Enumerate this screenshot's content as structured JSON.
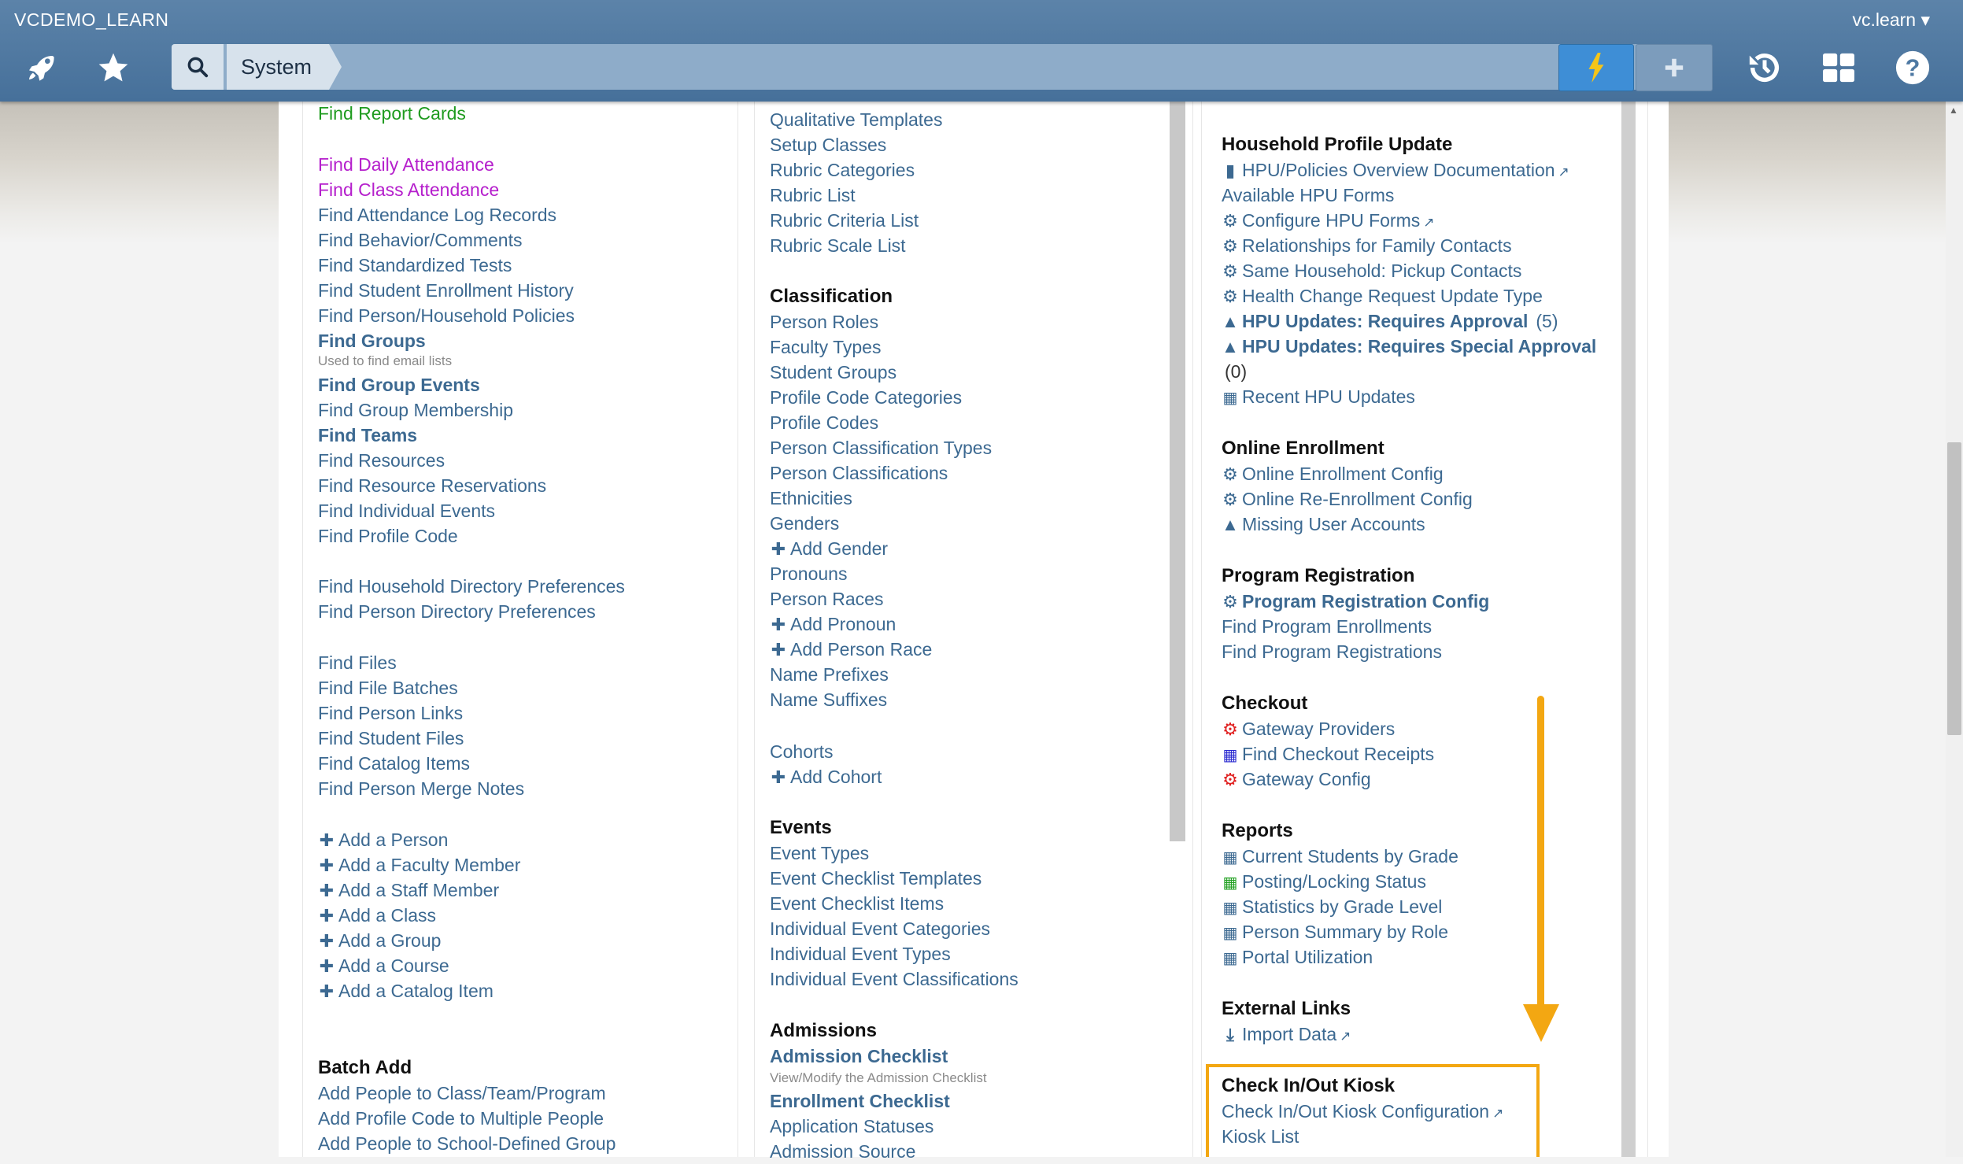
{
  "header": {
    "app_name": "VCDEMO_LEARN",
    "user_menu": "vc.learn ▾",
    "breadcrumb": "System"
  },
  "colors": {
    "header": "#4e79a3",
    "link": "#3c6991",
    "accent_annotation": "#f3a712",
    "bolt": "#f5c518"
  },
  "col1": {
    "find_report_cards": "Find Report Cards",
    "find_daily_attendance": "Find Daily Attendance",
    "find_class_attendance": "Find Class Attendance",
    "find_attendance_log": "Find Attendance Log Records",
    "find_behavior": "Find Behavior/Comments",
    "find_standardized_tests": "Find Standardized Tests",
    "find_enrollment_history": "Find Student Enrollment History",
    "find_person_household_policies": "Find Person/Household Policies",
    "find_groups": "Find Groups",
    "find_groups_note": "Used to find email lists",
    "find_group_events": "Find Group Events",
    "find_group_membership": "Find Group Membership",
    "find_teams": "Find Teams",
    "find_resources": "Find Resources",
    "find_resource_reservations": "Find Resource Reservations",
    "find_individual_events": "Find Individual Events",
    "find_profile_code": "Find Profile Code",
    "find_household_dir_prefs": "Find Household Directory Preferences",
    "find_person_dir_prefs": "Find Person Directory Preferences",
    "find_files": "Find Files",
    "find_file_batches": "Find File Batches",
    "find_person_links": "Find Person Links",
    "find_student_files": "Find Student Files",
    "find_catalog_items": "Find Catalog Items",
    "find_person_merge_notes": "Find Person Merge Notes",
    "add_person": "Add a Person",
    "add_faculty": "Add a Faculty Member",
    "add_staff": "Add a Staff Member",
    "add_class": "Add a Class",
    "add_group": "Add a Group",
    "add_course": "Add a Course",
    "add_catalog_item": "Add a Catalog Item",
    "batch_add_title": "Batch Add",
    "add_people_class": "Add People to Class/Team/Program",
    "add_profile_code_multi": "Add Profile Code to Multiple People",
    "add_people_group": "Add People to School-Defined Group"
  },
  "col2": {
    "qualitative_templates": "Qualitative Templates",
    "setup_classes": "Setup Classes",
    "rubric_categories": "Rubric Categories",
    "rubric_list": "Rubric List",
    "rubric_criteria_list": "Rubric Criteria List",
    "rubric_scale_list": "Rubric Scale List",
    "classification_title": "Classification",
    "person_roles": "Person Roles",
    "faculty_types": "Faculty Types",
    "student_groups": "Student Groups",
    "profile_code_categories": "Profile Code Categories",
    "profile_codes": "Profile Codes",
    "person_classification_types": "Person Classification Types",
    "person_classifications": "Person Classifications",
    "ethnicities": "Ethnicities",
    "genders": "Genders",
    "add_gender": "Add Gender",
    "pronouns": "Pronouns",
    "person_races": "Person Races",
    "add_pronoun": "Add Pronoun",
    "add_person_race": "Add Person Race",
    "name_prefixes": "Name Prefixes",
    "name_suffixes": "Name Suffixes",
    "cohorts": "Cohorts",
    "add_cohort": "Add Cohort",
    "events_title": "Events",
    "event_types": "Event Types",
    "event_checklist_templates": "Event Checklist Templates",
    "event_checklist_items": "Event Checklist Items",
    "individual_event_categories": "Individual Event Categories",
    "individual_event_types": "Individual Event Types",
    "individual_event_classifications": "Individual Event Classifications",
    "admissions_title": "Admissions",
    "admission_checklist": "Admission Checklist",
    "admission_checklist_note": "View/Modify the Admission Checklist",
    "enrollment_checklist": "Enrollment Checklist",
    "application_statuses": "Application Statuses",
    "admission_source": "Admission Source"
  },
  "col3": {
    "hpu_title": "Household Profile Update",
    "hpu_docs": "HPU/Policies Overview Documentation",
    "available_hpu_forms": "Available HPU Forms",
    "configure_hpu_forms": "Configure HPU Forms",
    "relationships_family": "Relationships for Family Contacts",
    "same_household": "Same Household: Pickup Contacts",
    "health_change": "Health Change Request Update Type",
    "hpu_requires_approval": "HPU Updates: Requires Approval",
    "hpu_requires_approval_count": "(5)",
    "hpu_requires_special": "HPU Updates: Requires Special Approval",
    "hpu_requires_special_count": "(0)",
    "recent_hpu": "Recent HPU Updates",
    "online_enrollment_title": "Online Enrollment",
    "online_enrollment_config": "Online Enrollment Config",
    "online_reenrollment_config": "Online Re-Enrollment Config",
    "missing_user_accounts": "Missing User Accounts",
    "program_reg_title": "Program Registration",
    "program_reg_config": "Program Registration Config",
    "find_program_enrollments": "Find Program Enrollments",
    "find_program_registrations": "Find Program Registrations",
    "checkout_title": "Checkout",
    "gateway_providers": "Gateway Providers",
    "find_checkout_receipts": "Find Checkout Receipts",
    "gateway_config": "Gateway Config",
    "reports_title": "Reports",
    "current_students_grade": "Current Students by Grade",
    "posting_locking": "Posting/Locking Status",
    "stats_grade_level": "Statistics by Grade Level",
    "person_summary_role": "Person Summary by Role",
    "portal_utilization": "Portal Utilization",
    "external_links_title": "External Links",
    "import_data": "Import Data",
    "kiosk_title": "Check In/Out Kiosk",
    "kiosk_config": "Check In/Out Kiosk Configuration",
    "kiosk_list": "Kiosk List"
  },
  "icons": {
    "rocket": "rocket-icon",
    "star": "star-icon",
    "search": "search-icon",
    "bolt": "bolt-icon",
    "plus": "plus-icon",
    "history": "history-icon",
    "grid": "grid-icon",
    "help": "help-icon"
  }
}
